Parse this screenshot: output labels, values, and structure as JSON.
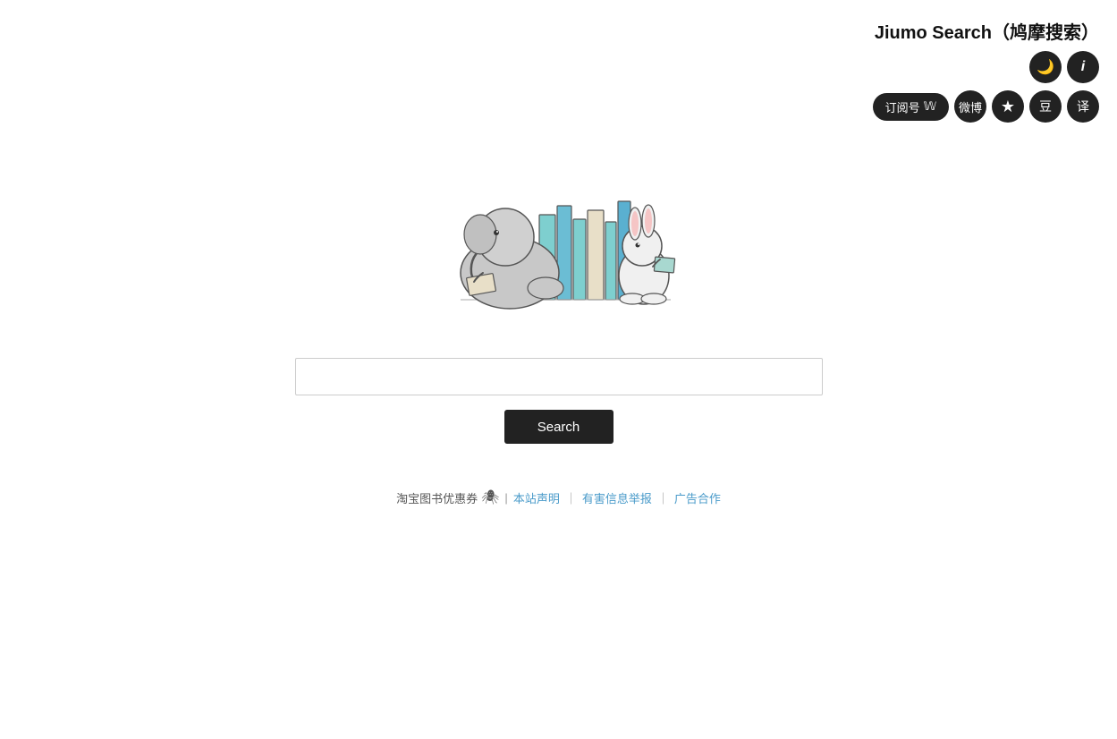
{
  "header": {
    "title": "Jiumo Search（鸠摩搜索）",
    "icons": {
      "moon": "🌙",
      "info": "ℹ",
      "subscribe_label": "订阅号",
      "wechat_icon": "微",
      "weibo_icon": "微",
      "star_icon": "★",
      "douban_icon": "豆",
      "translate_icon": "译"
    }
  },
  "search": {
    "placeholder": "",
    "button_label": "Search",
    "input_value": ""
  },
  "footer": {
    "taobao_text": "淘宝图书优惠券",
    "link1_text": "本站声明",
    "link2_text": "有害信息举报",
    "link3_text": "广告合作",
    "sep1": "|",
    "sep2": "｜",
    "sep3": "｜"
  }
}
